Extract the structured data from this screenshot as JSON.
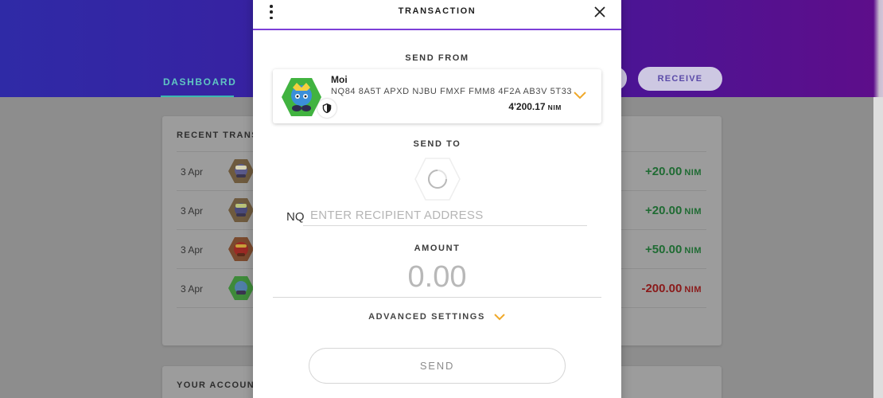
{
  "background": {
    "tabs": [
      {
        "label": "DASHBOARD",
        "active": true
      }
    ],
    "header_buttons": {
      "receive_label": "RECEIVE"
    },
    "recent_card": {
      "title": "RECENT TRANS",
      "rows": [
        {
          "date": "3 Apr",
          "amount": "+20.00",
          "unit": "NIM",
          "direction": "in"
        },
        {
          "date": "3 Apr",
          "amount": "+20.00",
          "unit": "NIM",
          "direction": "in"
        },
        {
          "date": "3 Apr",
          "amount": "+50.00",
          "unit": "NIM",
          "direction": "in"
        },
        {
          "date": "3 Apr",
          "amount": "-200.00",
          "unit": "NIM",
          "direction": "out"
        }
      ]
    },
    "accounts_card": {
      "title": "YOUR ACCOUNT"
    }
  },
  "modal": {
    "title": "TRANSACTION",
    "menu_icon": "more-vertical-icon",
    "close_icon": "close-icon",
    "send_from": {
      "label": "SEND FROM",
      "account_name": "Moi",
      "address": "NQ84 8A5T APXD NJBU FMXF FMM8 4F2A AB3V 5T33",
      "balance": "4'200.17",
      "unit": "NIM",
      "badge_icon": "shield-icon",
      "chevron_icon": "chevron-down-icon"
    },
    "send_to": {
      "label": "SEND TO",
      "prefix": "NQ",
      "placeholder": "ENTER RECIPIENT ADDRESS",
      "value": ""
    },
    "amount": {
      "label": "AMOUNT",
      "placeholder": "0.00",
      "value": ""
    },
    "advanced": {
      "label": "ADVANCED SETTINGS",
      "chevron_icon": "chevron-down-icon"
    },
    "send_button": {
      "label": "SEND"
    }
  },
  "colors": {
    "accent_purple": "#7d3fd8",
    "chevron_gold": "#f0a92a",
    "positive_green": "#1f6b33",
    "negative_red": "#8a1a1a",
    "teal_tab": "#3bb8b2"
  }
}
